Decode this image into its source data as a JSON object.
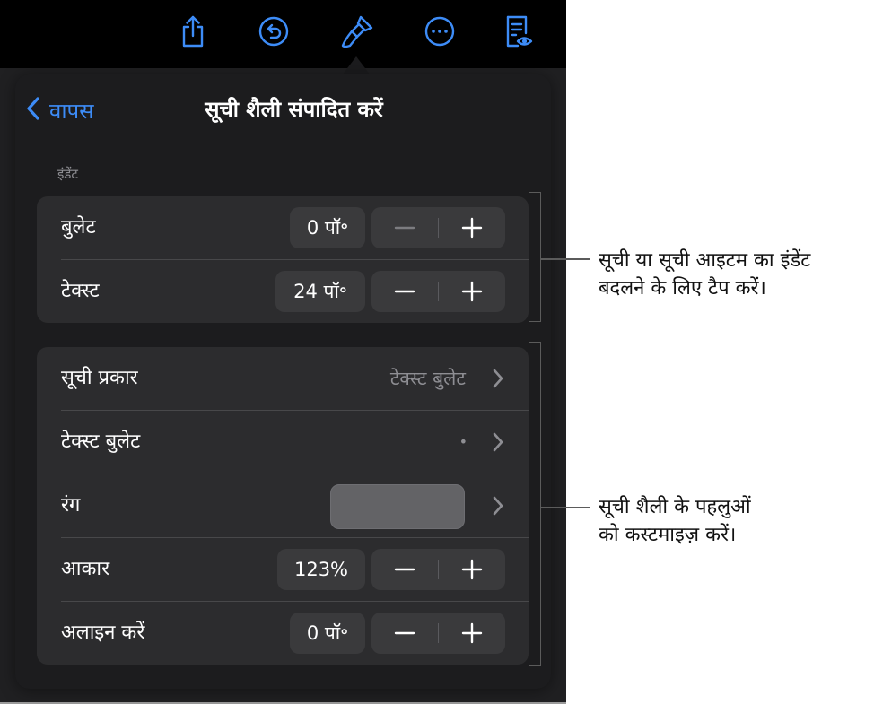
{
  "popover": {
    "back_label": "वापस",
    "title": "सूची शैली संपादित करें",
    "indent_section_label": "इंडेंट",
    "indent_rows": [
      {
        "label": "बुलेट",
        "value": "0 पॉ॰"
      },
      {
        "label": "टेक्स्ट",
        "value": "24 पॉ॰"
      }
    ],
    "style_rows": {
      "list_type": {
        "label": "सूची प्रकार",
        "value": "टेक्स्ट बुलेट"
      },
      "text_bullet": {
        "label": "टेक्स्ट बुलेट",
        "value": "•"
      },
      "color": {
        "label": "रंग",
        "swatch_color": "#636366"
      },
      "size": {
        "label": "आकार",
        "value": "123%"
      },
      "align": {
        "label": "अलाइन करें",
        "value": "0 पॉ॰"
      }
    }
  },
  "callouts": {
    "indent_line1": "सूची या सूची आइटम का इंडेंट",
    "indent_line2": "बदलने के लिए टैप करें।",
    "style_line1": "सूची शैली के पहलुओं",
    "style_line2": "को कस्टमाइज़ करें।"
  },
  "colors": {
    "accent": "#3d8cf7",
    "popover_bg": "#1c1c1e",
    "group_bg": "#2c2c2e",
    "control_bg": "#3a3a3c"
  }
}
